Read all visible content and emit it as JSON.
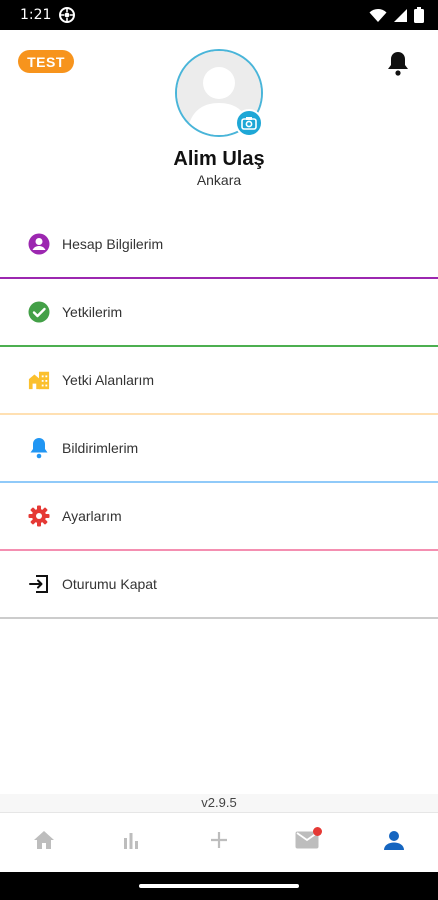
{
  "status_bar": {
    "time": "1:21"
  },
  "header": {
    "test_badge": "TEST",
    "user_name": "Alim Ulaş",
    "user_city": "Ankara"
  },
  "menu": {
    "items": [
      {
        "label": "Hesap Bilgilerim",
        "icon": "account-circle-icon",
        "color": "#9C27B0"
      },
      {
        "label": "Yetkilerim",
        "icon": "check-circle-icon",
        "color": "#4CAF50"
      },
      {
        "label": "Yetki Alanlarım",
        "icon": "buildings-icon",
        "color": "#FBC02D"
      },
      {
        "label": "Bildirimlerim",
        "icon": "bell-icon",
        "color": "#2196F3"
      },
      {
        "label": "Ayarlarım",
        "icon": "gear-icon",
        "color": "#E53935"
      },
      {
        "label": "Oturumu Kapat",
        "icon": "logout-icon",
        "color": "#cccccc"
      }
    ]
  },
  "version": "v2.9.5",
  "bottom_nav": {
    "items": [
      "home-icon",
      "chart-icon",
      "plus-icon",
      "mail-icon",
      "profile-icon"
    ],
    "active": "profile-icon",
    "active_color": "#1565C0",
    "inactive_color": "#BDBDBD"
  }
}
